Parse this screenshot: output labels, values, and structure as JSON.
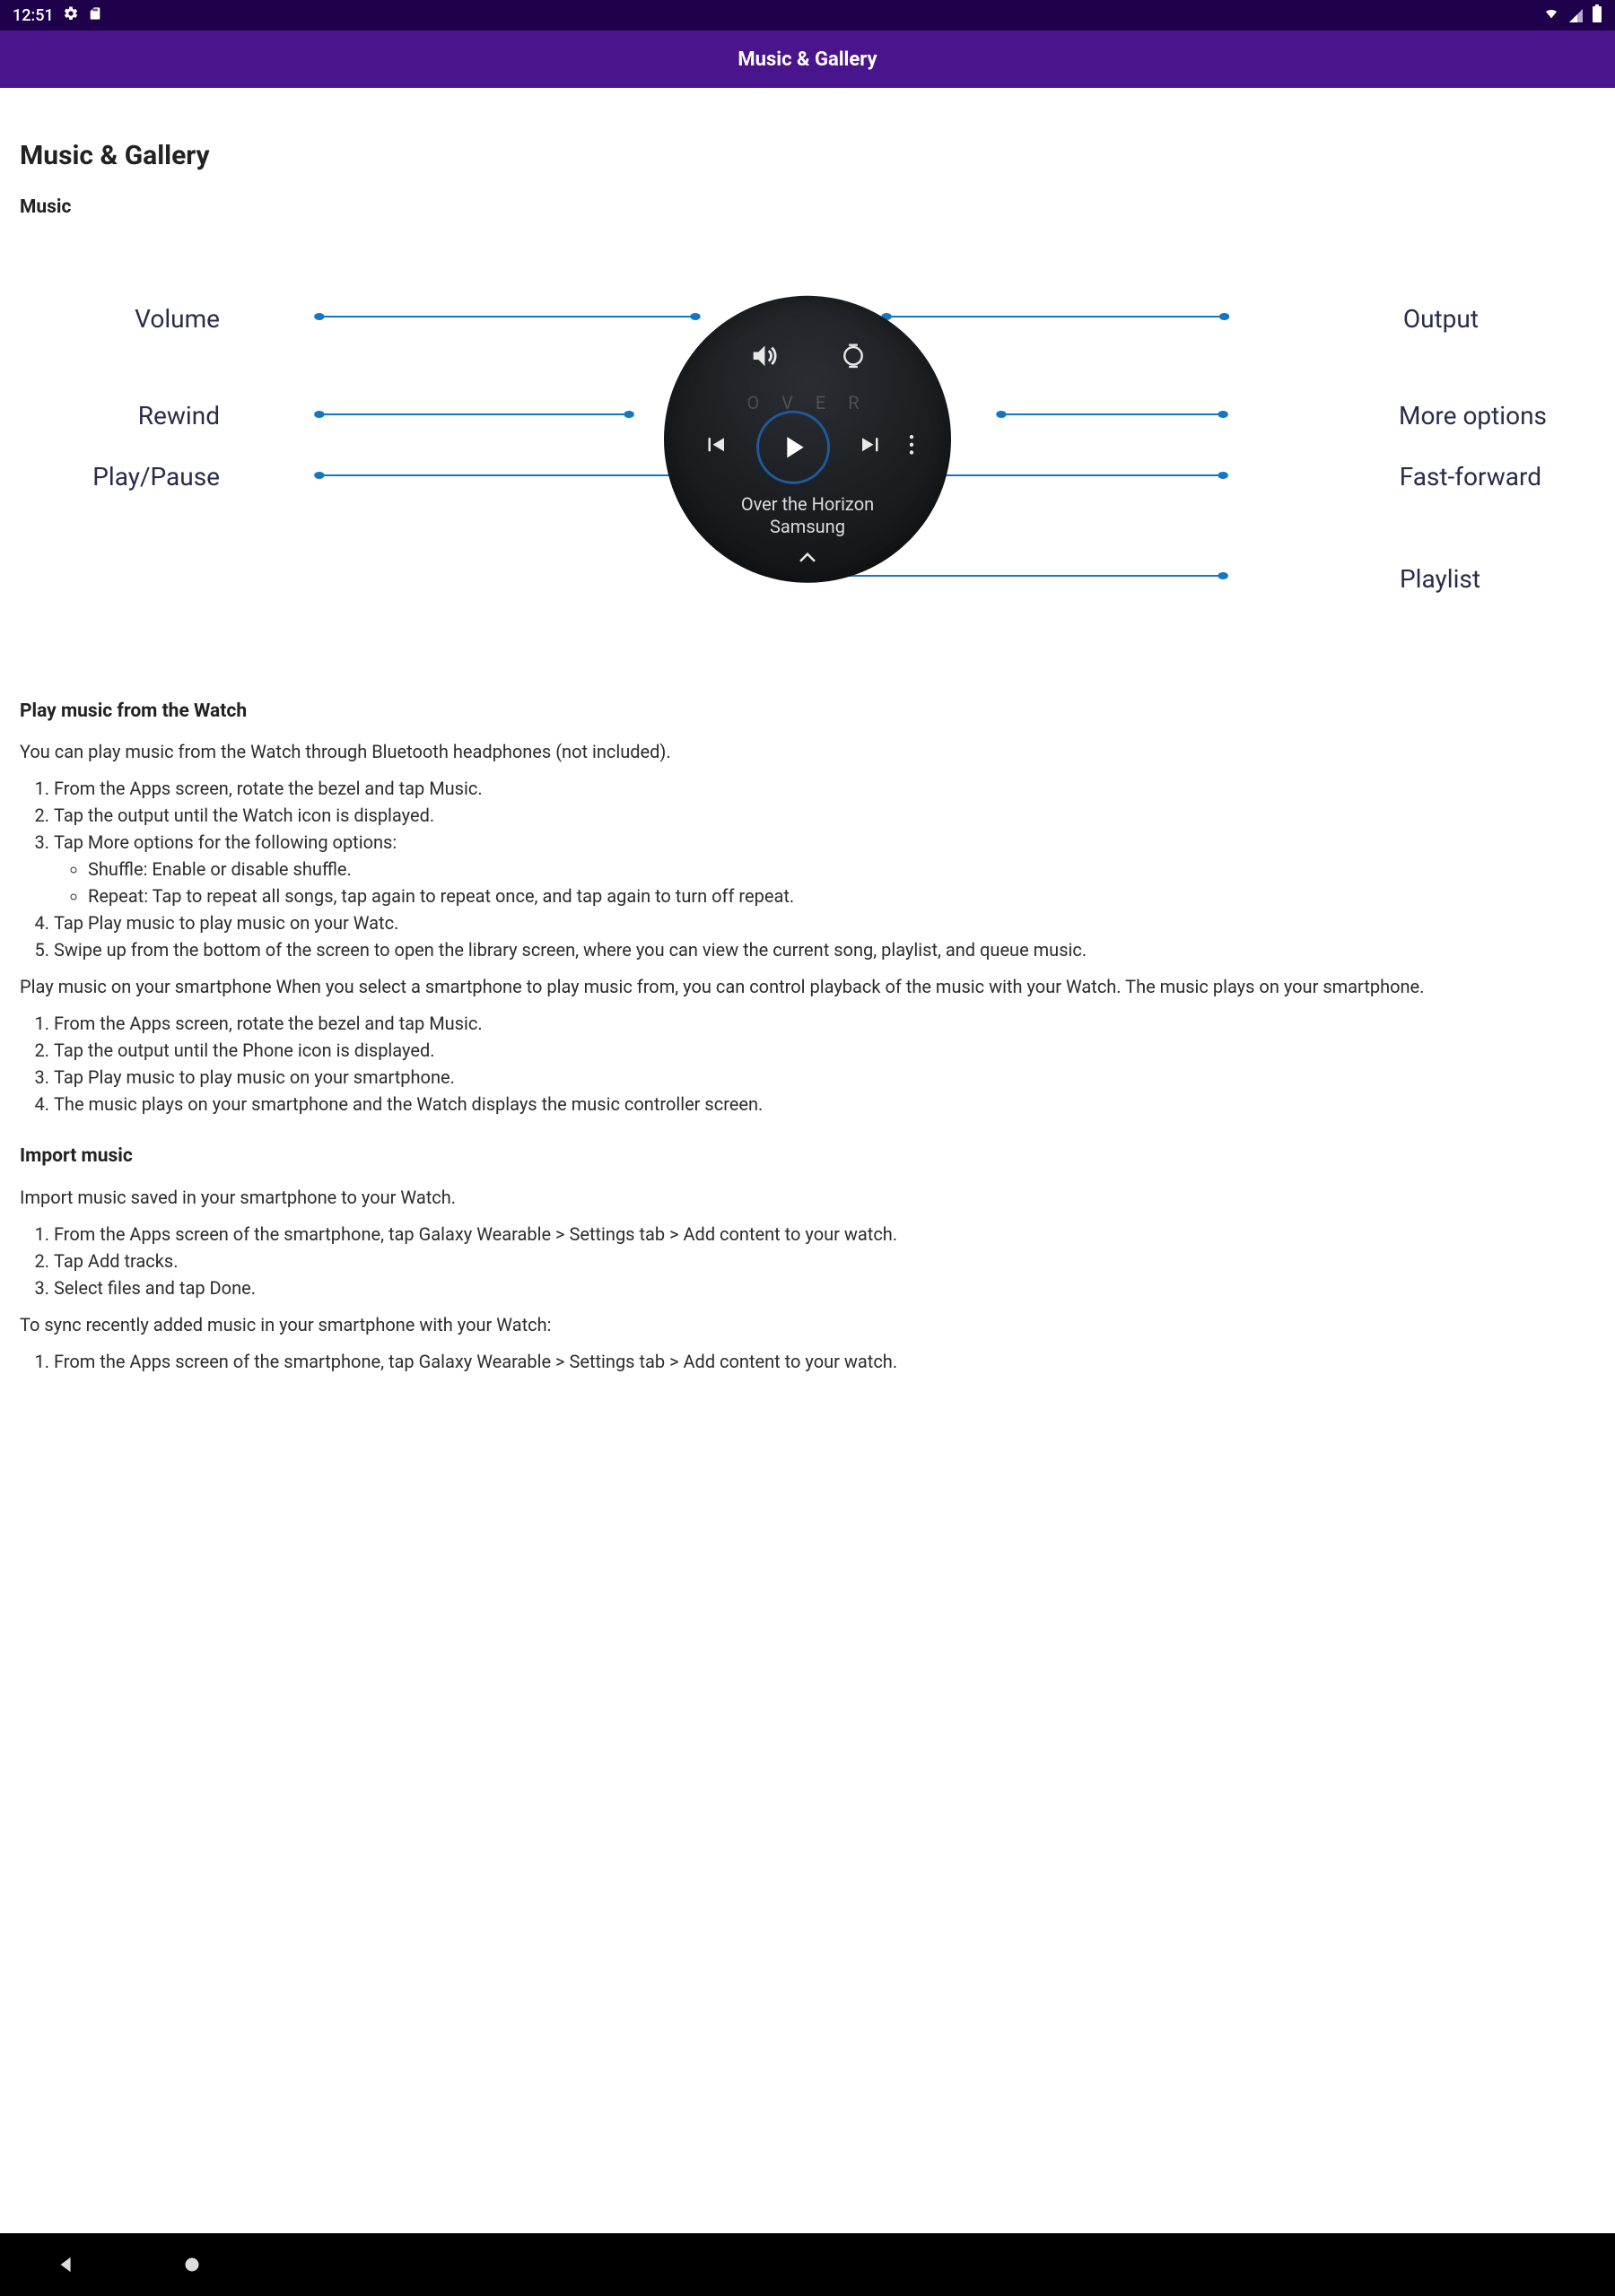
{
  "status": {
    "time": "12:51"
  },
  "appbar": {
    "title": "Music & Gallery"
  },
  "page": {
    "h1": "Music & Gallery",
    "music_h2": "Music",
    "diagram": {
      "volume": "Volume",
      "rewind": "Rewind",
      "playpause": "Play/Pause",
      "output": "Output",
      "more": "More options",
      "fastforward": "Fast-forward",
      "playlist": "Playlist",
      "song_title": "Over the Horizon",
      "song_artist": "Samsung",
      "ghost_text": "O V E R"
    },
    "sec1_h3": "Play music from the Watch",
    "sec1_p": "You can play music from the Watch through Bluetooth headphones (not included).",
    "sec1_list": {
      "i1": "From the Apps screen, rotate the bezel and tap Music.",
      "i2": "Tap the output until the Watch icon is  displayed.",
      "i3": "Tap More options for the following options:",
      "i3a": "Shuffle: Enable or disable shuffle.",
      "i3b": "Repeat: Tap to repeat all songs, tap again to repeat once, and tap again to turn off repeat.",
      "i4": "Tap Play music to play music on your Watc.",
      "i5": "Swipe up from the bottom of the screen to open the library screen, where you can view the current song, playlist, and queue music."
    },
    "sec1_p2": "Play music on your smartphone When you select a smartphone to play music from, you can control playback of the music with your Watch. The music plays on your smartphone.",
    "sec1b_list": {
      "i1": "From the Apps screen, rotate the bezel and tap Music.",
      "i2": "Tap the output until the Phone icon is  displayed.",
      "i3": "Tap Play music to play music on your smartphone.",
      "i4": "The music plays on your smartphone and the Watch displays the music controller screen."
    },
    "sec2_h3": "Import music",
    "sec2_p": "Import music saved in your smartphone to your Watch.",
    "sec2_list": {
      "i1": "From the Apps screen of the smartphone, tap Galaxy Wearable > Settings tab > Add content to your watch.",
      "i2": "Tap Add tracks.",
      "i3": "Select files and tap Done."
    },
    "sec2_p2": "To sync recently added music in your smartphone with your Watch:",
    "sec2b_list": {
      "i1": "From the Apps screen of the smartphone, tap Galaxy Wearable > Settings tab > Add content to your watch."
    }
  }
}
